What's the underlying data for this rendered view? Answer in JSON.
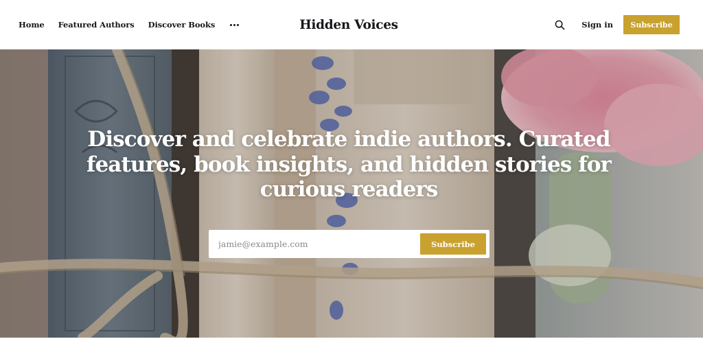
{
  "nav": {
    "items": [
      {
        "label": "Home"
      },
      {
        "label": "Featured Authors"
      },
      {
        "label": "Discover Books"
      }
    ],
    "more_icon": "ellipsis-icon"
  },
  "brand": {
    "title": "Hidden Voices"
  },
  "actions": {
    "search_icon": "search-icon",
    "signin_label": "Sign in",
    "subscribe_label": "Subscribe"
  },
  "hero": {
    "headline": "Discover and celebrate indie authors. Curated features, book insights, and hidden stories for curious readers",
    "email_placeholder": "jamie@example.com",
    "subscribe_label": "Subscribe"
  },
  "colors": {
    "accent": "#c9a12f",
    "text": "#15171a",
    "header_bg": "#ffffff"
  }
}
